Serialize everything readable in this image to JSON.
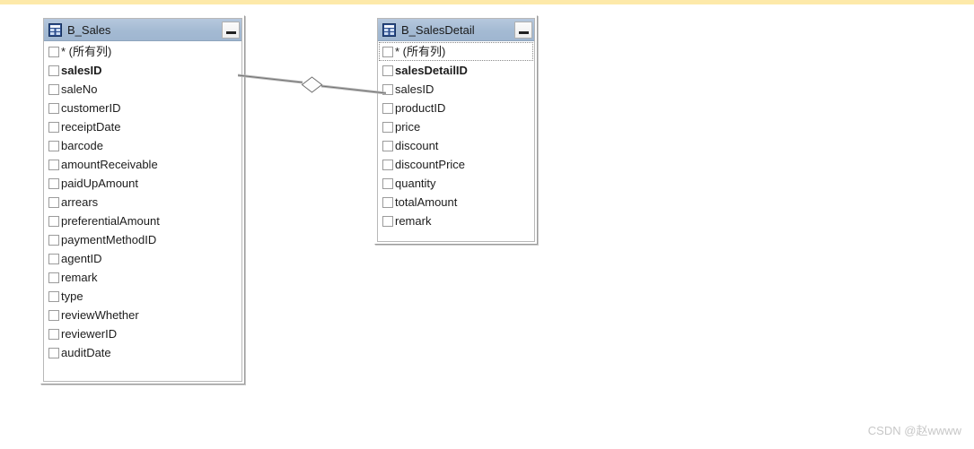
{
  "window": {
    "background_color": "#ffffff",
    "top_band_color": "#fde9a9",
    "title_bar_color": "#a4bad3"
  },
  "tables": [
    {
      "name": "B_Sales",
      "icon": "table-icon",
      "minimize_label": "_",
      "columns": [
        {
          "label": "* (所有列)",
          "primary_key": false,
          "checked": false,
          "focused": false
        },
        {
          "label": "salesID",
          "primary_key": true,
          "checked": false,
          "focused": false
        },
        {
          "label": "saleNo",
          "primary_key": false,
          "checked": false,
          "focused": false
        },
        {
          "label": "customerID",
          "primary_key": false,
          "checked": false,
          "focused": false
        },
        {
          "label": "receiptDate",
          "primary_key": false,
          "checked": false,
          "focused": false
        },
        {
          "label": "barcode",
          "primary_key": false,
          "checked": false,
          "focused": false
        },
        {
          "label": "amountReceivable",
          "primary_key": false,
          "checked": false,
          "focused": false
        },
        {
          "label": "paidUpAmount",
          "primary_key": false,
          "checked": false,
          "focused": false
        },
        {
          "label": "arrears",
          "primary_key": false,
          "checked": false,
          "focused": false
        },
        {
          "label": "preferentialAmount",
          "primary_key": false,
          "checked": false,
          "focused": false
        },
        {
          "label": "paymentMethodID",
          "primary_key": false,
          "checked": false,
          "focused": false
        },
        {
          "label": "agentID",
          "primary_key": false,
          "checked": false,
          "focused": false
        },
        {
          "label": "remark",
          "primary_key": false,
          "checked": false,
          "focused": false
        },
        {
          "label": "type",
          "primary_key": false,
          "checked": false,
          "focused": false
        },
        {
          "label": "reviewWhether",
          "primary_key": false,
          "checked": false,
          "focused": false
        },
        {
          "label": "reviewerID",
          "primary_key": false,
          "checked": false,
          "focused": false
        },
        {
          "label": "auditDate",
          "primary_key": false,
          "checked": false,
          "focused": false
        }
      ]
    },
    {
      "name": "B_SalesDetail",
      "icon": "table-icon",
      "minimize_label": "_",
      "columns": [
        {
          "label": "* (所有列)",
          "primary_key": false,
          "checked": false,
          "focused": true
        },
        {
          "label": "salesDetailID",
          "primary_key": true,
          "checked": false,
          "focused": false
        },
        {
          "label": "salesID",
          "primary_key": false,
          "checked": false,
          "focused": false
        },
        {
          "label": "productID",
          "primary_key": false,
          "checked": false,
          "focused": false
        },
        {
          "label": "price",
          "primary_key": false,
          "checked": false,
          "focused": false
        },
        {
          "label": "discount",
          "primary_key": false,
          "checked": false,
          "focused": false
        },
        {
          "label": "discountPrice",
          "primary_key": false,
          "checked": false,
          "focused": false
        },
        {
          "label": "quantity",
          "primary_key": false,
          "checked": false,
          "focused": false
        },
        {
          "label": "totalAmount",
          "primary_key": false,
          "checked": false,
          "focused": false
        },
        {
          "label": "remark",
          "primary_key": false,
          "checked": false,
          "focused": false
        }
      ]
    }
  ],
  "relation": {
    "type": "one-to-many",
    "from_table": "B_Sales",
    "to_table": "B_SalesDetail",
    "marker": "diamond"
  },
  "watermark": {
    "text": "CSDN @赵wwww"
  }
}
